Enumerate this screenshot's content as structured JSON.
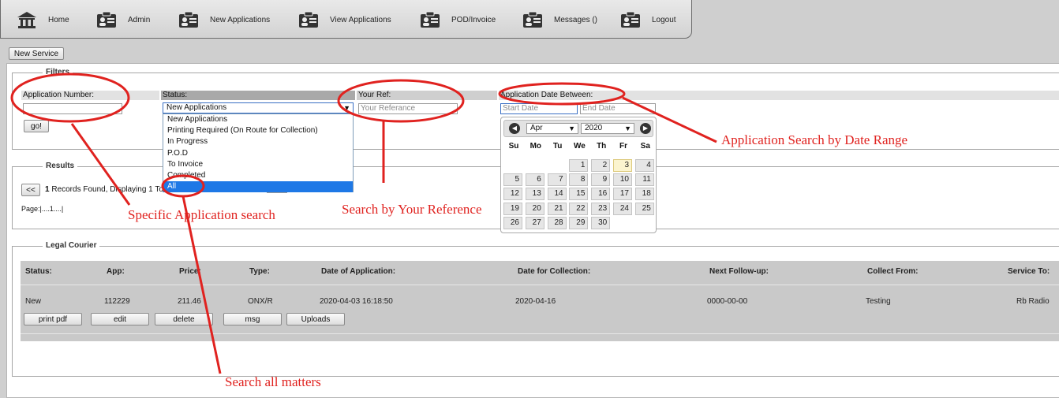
{
  "nav": {
    "items": [
      {
        "label": "Home",
        "icon": "home-icon"
      },
      {
        "label": "Admin",
        "icon": "id-card-icon"
      },
      {
        "label": "New Applications",
        "icon": "id-card-icon"
      },
      {
        "label": "View Applications",
        "icon": "id-card-icon"
      },
      {
        "label": "POD/Invoice",
        "icon": "id-card-icon"
      },
      {
        "label": "Messages ()",
        "icon": "id-card-icon"
      },
      {
        "label": "Logout",
        "icon": "id-card-icon"
      }
    ]
  },
  "toolbar": {
    "new_service": "New Service"
  },
  "filters": {
    "legend": "Filters",
    "app_number_label": "Application Number:",
    "status_label": "Status:",
    "status_value": "New Applications",
    "status_options": [
      "New Applications",
      "Printing Required (On Route for Collection)",
      "In Progress",
      "P.O.D",
      "To Invoice",
      "Completed",
      "All"
    ],
    "your_ref_label": "Your Ref:",
    "your_ref_placeholder": "Your Referance",
    "date_label": "Application Date Between:",
    "start_placeholder": "Start Date",
    "end_placeholder": "End Date",
    "go": "go!"
  },
  "calendar": {
    "month": "Apr",
    "year": "2020",
    "weekdays": [
      "Su",
      "Mo",
      "Tu",
      "We",
      "Th",
      "Fr",
      "Sa"
    ],
    "days": [
      "1",
      "2",
      "3",
      "4",
      "5",
      "6",
      "7",
      "8",
      "9",
      "10",
      "11",
      "12",
      "13",
      "14",
      "15",
      "16",
      "17",
      "18",
      "19",
      "20",
      "21",
      "22",
      "23",
      "24",
      "25",
      "26",
      "27",
      "28",
      "29",
      "30"
    ],
    "today": "3"
  },
  "results": {
    "legend": "Results",
    "prev": "<<",
    "count": "1",
    "summary": " Records Found, Displaying 1 To",
    "page": "Page:|....1....|"
  },
  "courier": {
    "legend": "Legal Courier",
    "headers": [
      "Status:",
      "App:",
      "Price:",
      "Type:",
      "Date of Application:",
      "Date for Collection:",
      "Next Follow-up:",
      "Collect From:",
      "Service To:"
    ],
    "row": [
      "New",
      "112229",
      "211.46",
      "ONX/R",
      "2020-04-03 16:18:50",
      "2020-04-16",
      "0000-00-00",
      "Testing",
      "Rb Radio"
    ],
    "buttons": [
      "print pdf",
      "edit",
      "delete",
      "msg",
      "Uploads"
    ]
  },
  "annotations": {
    "color": "#e0221f",
    "date_range": "Application Search by Date Range",
    "specific": "Specific Application search",
    "your_ref": "Search by Your Reference",
    "all": "Search all matters"
  }
}
